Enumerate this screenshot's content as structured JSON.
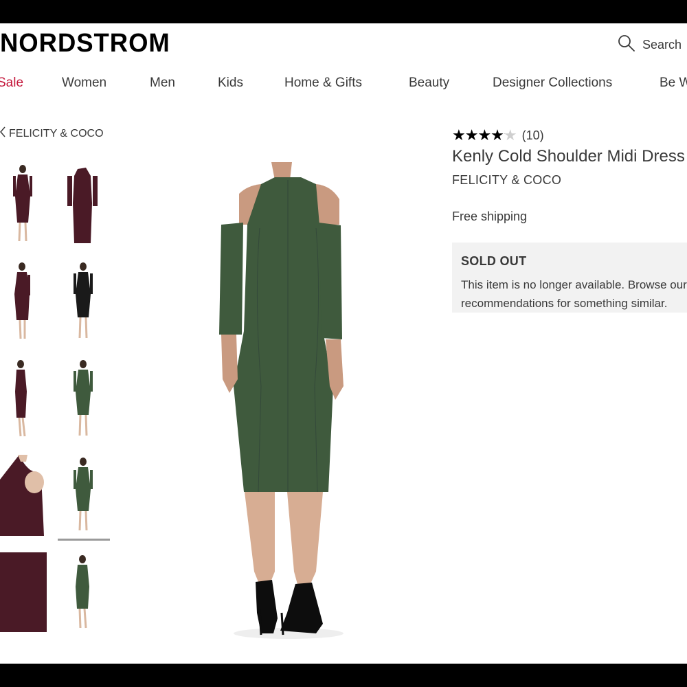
{
  "header": {
    "logo": "NORDSTROM",
    "search_label": "Search"
  },
  "nav": {
    "items": [
      "Sale",
      "Women",
      "Men",
      "Kids",
      "Home & Gifts",
      "Beauty",
      "Designer Collections",
      "Be W"
    ]
  },
  "breadcrumb": {
    "label": "FELICITY & COCO"
  },
  "product": {
    "rating_value": 4.1,
    "review_count": "(10)",
    "title": "Kenly Cold Shoulder Midi Dress",
    "brand": "FELICITY & COCO",
    "shipping": "Free shipping",
    "status_heading": "SOLD OUT",
    "status_message": "This item is no longer available. Browse our recommendations for something similar."
  },
  "colors": {
    "accent_sale": "#c4183c",
    "dress_green": "#3f5a3d",
    "dress_burgundy": "#4a1a26",
    "dress_black": "#1a1a1a",
    "soldout_bg": "#f2f2f2"
  },
  "thumbnails": {
    "selected_index": 7,
    "items": [
      {
        "color": "burgundy",
        "view": "front-model"
      },
      {
        "color": "burgundy",
        "view": "flat"
      },
      {
        "color": "burgundy",
        "view": "side-model"
      },
      {
        "color": "black",
        "view": "front-model"
      },
      {
        "color": "burgundy",
        "view": "side-model"
      },
      {
        "color": "green",
        "view": "front-model"
      },
      {
        "color": "burgundy",
        "view": "shoulder-detail"
      },
      {
        "color": "green",
        "view": "back-model"
      },
      {
        "color": "burgundy",
        "view": "fabric-swatch"
      },
      {
        "color": "green",
        "view": "side-model"
      }
    ]
  }
}
